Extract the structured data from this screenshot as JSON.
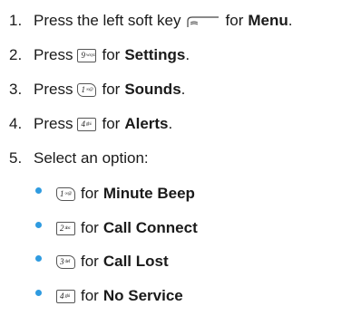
{
  "steps": [
    {
      "num": "1.",
      "pre": "Press the left soft key",
      "post": "for",
      "bold": "Menu",
      "end": "."
    },
    {
      "num": "2.",
      "pre": "Press",
      "key": {
        "main": "9",
        "sub": "wxyz"
      },
      "post": "for",
      "bold": "Settings",
      "end": "."
    },
    {
      "num": "3.",
      "pre": "Press",
      "key": {
        "main": "1",
        "sub": "∞@"
      },
      "post": "for",
      "bold": "Sounds",
      "end": "."
    },
    {
      "num": "4.",
      "pre": "Press",
      "key": {
        "main": "4",
        "sub": "ghi"
      },
      "post": "for",
      "bold": "Alerts",
      "end": "."
    },
    {
      "num": "5.",
      "text": "Select an option:"
    }
  ],
  "options": [
    {
      "key": {
        "main": "1",
        "sub": "∞@"
      },
      "post": "for",
      "bold": "Minute Beep"
    },
    {
      "key": {
        "main": "2",
        "sub": "abc"
      },
      "post": "for",
      "bold": "Call Connect"
    },
    {
      "key": {
        "main": "3",
        "sub": "def"
      },
      "post": "for",
      "bold": "Call Lost"
    },
    {
      "key": {
        "main": "4",
        "sub": "ghi"
      },
      "post": "for",
      "bold": "No Service"
    }
  ],
  "colors": {
    "bullet": "#2f9be0",
    "text": "#1a1a1a"
  },
  "icons": {
    "softkey": "left-soft-key-icon"
  }
}
